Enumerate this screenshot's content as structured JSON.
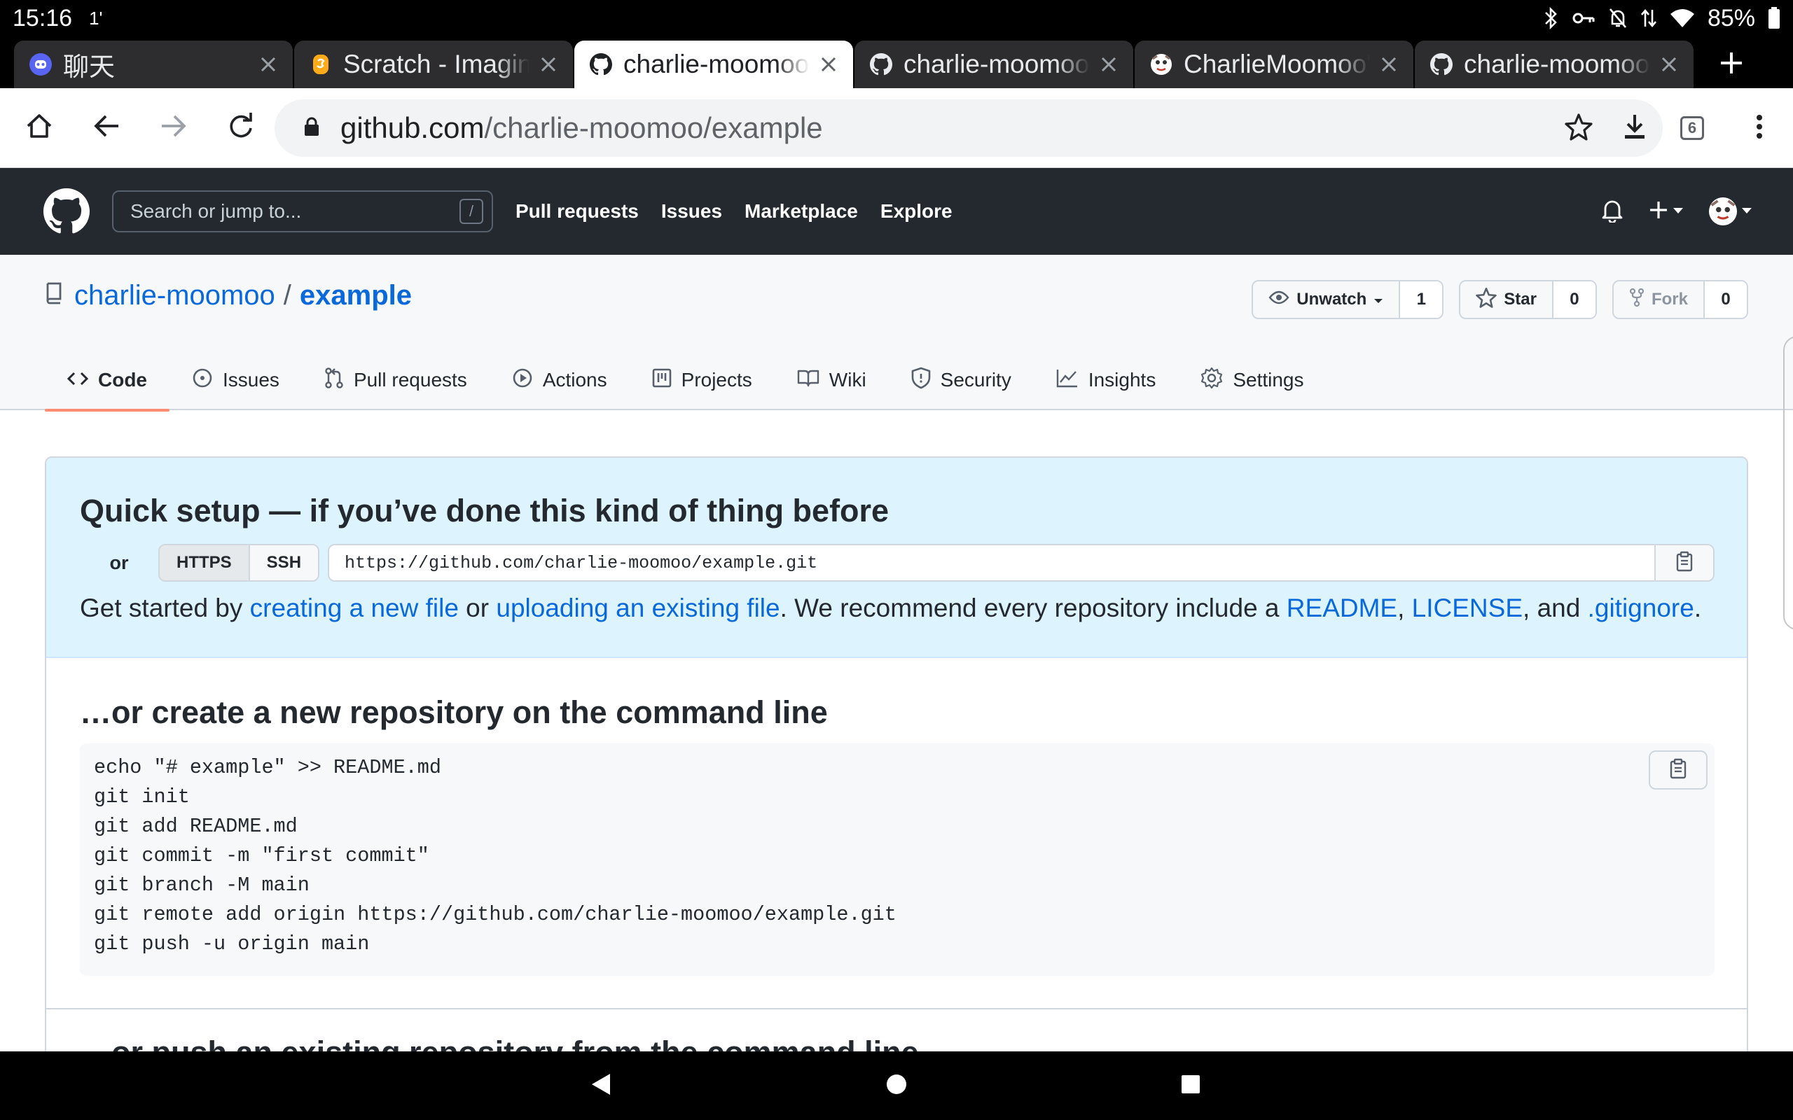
{
  "status_bar": {
    "time": "15:16",
    "extra": "1'",
    "battery": "85%"
  },
  "tabs": [
    {
      "title": "聊天",
      "favicon": "discord-icon",
      "active": false
    },
    {
      "title": "Scratch - Imagine, Program, Share",
      "favicon": "scratch-icon",
      "active": false
    },
    {
      "title": "charlie-moomoo/example",
      "favicon": "github-icon",
      "active": true
    },
    {
      "title": "charlie-moomoo",
      "favicon": "github-icon",
      "active": false
    },
    {
      "title": "CharlieMoomoo's",
      "favicon": "avatar-icon",
      "active": false
    },
    {
      "title": "charlie-moomoo",
      "favicon": "github-icon",
      "active": false
    }
  ],
  "toolbar": {
    "url_host": "github.com",
    "url_path": "/charlie-moomoo/example",
    "tab_count": "6"
  },
  "gh_header": {
    "search_placeholder": "Search or jump to...",
    "search_shortcut": "/",
    "nav": [
      "Pull requests",
      "Issues",
      "Marketplace",
      "Explore"
    ]
  },
  "repo": {
    "owner": "charlie-moomoo",
    "separator": "/",
    "name": "example",
    "unwatch_label": "Unwatch",
    "watch_count": "1",
    "star_label": "Star",
    "star_count": "0",
    "fork_label": "Fork",
    "fork_count": "0",
    "tabs": [
      "Code",
      "Issues",
      "Pull requests",
      "Actions",
      "Projects",
      "Wiki",
      "Security",
      "Insights",
      "Settings"
    ]
  },
  "quick_setup": {
    "title": "Quick setup — if you’ve done this kind of thing before",
    "or_label": "or",
    "https_label": "HTTPS",
    "ssh_label": "SSH",
    "clone_url": "https://github.com/charlie-moomoo/example.git",
    "get_started_1": "Get started by ",
    "link_new_file": "creating a new file",
    "get_started_2": " or ",
    "link_upload": "uploading an existing file",
    "get_started_3": ". We recommend every repository include a ",
    "link_readme": "README",
    "comma": ", ",
    "link_license": "LICENSE",
    "and": ", and ",
    "link_gitignore": ".gitignore",
    "period": "."
  },
  "command_line": {
    "title": "…or create a new repository on the command line",
    "code": "echo \"# example\" >> README.md\ngit init\ngit add README.md\ngit commit -m \"first commit\"\ngit branch -M main\ngit remote add origin https://github.com/charlie-moomoo/example.git\ngit push -u origin main"
  },
  "next_section": {
    "title": "…or push an existing repository from the command line"
  },
  "colors": {
    "github_header": "#24292f",
    "link_blue": "#0969da",
    "quick_setup_bg": "#ddf4ff",
    "active_tab_underline": "#fd8c73"
  }
}
